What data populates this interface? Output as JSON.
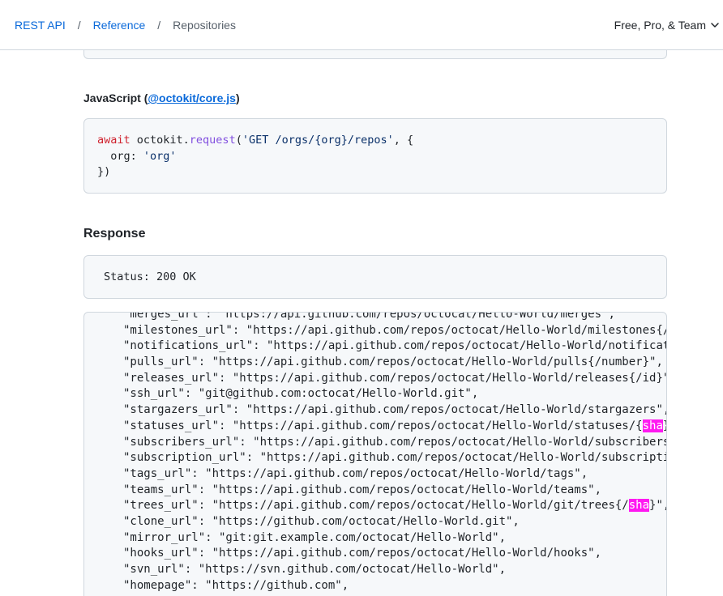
{
  "breadcrumb": {
    "items": [
      "REST API",
      "Reference",
      "Repositories"
    ],
    "separator": "/"
  },
  "version_picker": {
    "label": "Free, Pro, & Team"
  },
  "js_example": {
    "label_prefix": "JavaScript (",
    "label_link": "@octokit/core.js",
    "label_suffix": ")",
    "code": {
      "await": "await",
      "octokit": " octokit.",
      "request": "request",
      "open": "(",
      "path": "'GET /orgs/{org}/repos'",
      "after_path": ", {",
      "org_key": "  org: ",
      "org_val": "'org'",
      "close": "})"
    }
  },
  "response": {
    "heading": "Response",
    "status": "Status: 200 OK",
    "highlight_term": "sha",
    "lines": [
      "\"merges_url\": \"https://api.github.com/repos/octocat/Hello-World/merges\",",
      "\"milestones_url\": \"https://api.github.com/repos/octocat/Hello-World/milestones{/nu",
      "\"notifications_url\": \"https://api.github.com/repos/octocat/Hello-World/notificatio",
      "\"pulls_url\": \"https://api.github.com/repos/octocat/Hello-World/pulls{/number}\",",
      "\"releases_url\": \"https://api.github.com/repos/octocat/Hello-World/releases{/id}\",",
      "\"ssh_url\": \"git@github.com:octocat/Hello-World.git\",",
      "\"stargazers_url\": \"https://api.github.com/repos/octocat/Hello-World/stargazers\",",
      "\"statuses_url\": \"https://api.github.com/repos/octocat/Hello-World/statuses/{sha}\",",
      "\"subscribers_url\": \"https://api.github.com/repos/octocat/Hello-World/subscribers\",",
      "\"subscription_url\": \"https://api.github.com/repos/octocat/Hello-World/subscription",
      "\"tags_url\": \"https://api.github.com/repos/octocat/Hello-World/tags\",",
      "\"teams_url\": \"https://api.github.com/repos/octocat/Hello-World/teams\",",
      "\"trees_url\": \"https://api.github.com/repos/octocat/Hello-World/git/trees{/sha}\",",
      "\"clone_url\": \"https://github.com/octocat/Hello-World.git\",",
      "\"mirror_url\": \"git:git.example.com/octocat/Hello-World\",",
      "\"hooks_url\": \"https://api.github.com/repos/octocat/Hello-World/hooks\",",
      "\"svn_url\": \"https://svn.github.com/octocat/Hello-World\",",
      "\"homepage\": \"https://github.com\","
    ]
  },
  "colors": {
    "link": "#0969da",
    "keyword": "#cf222e",
    "function": "#8250df",
    "string": "#0a3069",
    "highlight": "#ff19f1",
    "code_bg": "#f6f8fa",
    "border": "#d0d7de"
  }
}
